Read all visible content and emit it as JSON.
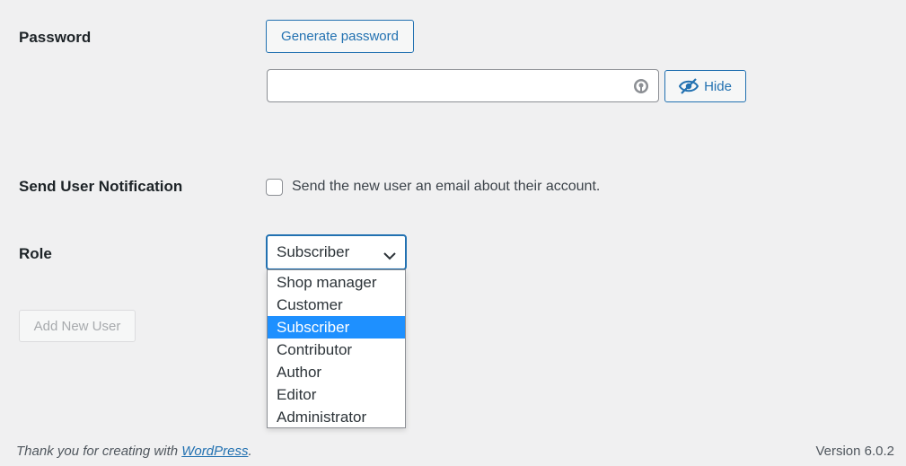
{
  "password": {
    "label": "Password",
    "generate_button": "Generate password",
    "input_value": "",
    "hide_button": "Hide"
  },
  "notification": {
    "label": "Send User Notification",
    "checkbox_label": "Send the new user an email about their account.",
    "checked": false
  },
  "role": {
    "label": "Role",
    "selected": "Subscriber",
    "options": [
      "Shop manager",
      "Customer",
      "Subscriber",
      "Contributor",
      "Author",
      "Editor",
      "Administrator"
    ]
  },
  "submit": {
    "label": "Add New User"
  },
  "footer": {
    "thanks_prefix": "Thank you for creating with ",
    "link_text": "WordPress",
    "thanks_suffix": ".",
    "version": "Version 6.0.2"
  },
  "colors": {
    "accent": "#2271b1",
    "highlight": "#1e90ff",
    "background": "#f0f0f1"
  }
}
